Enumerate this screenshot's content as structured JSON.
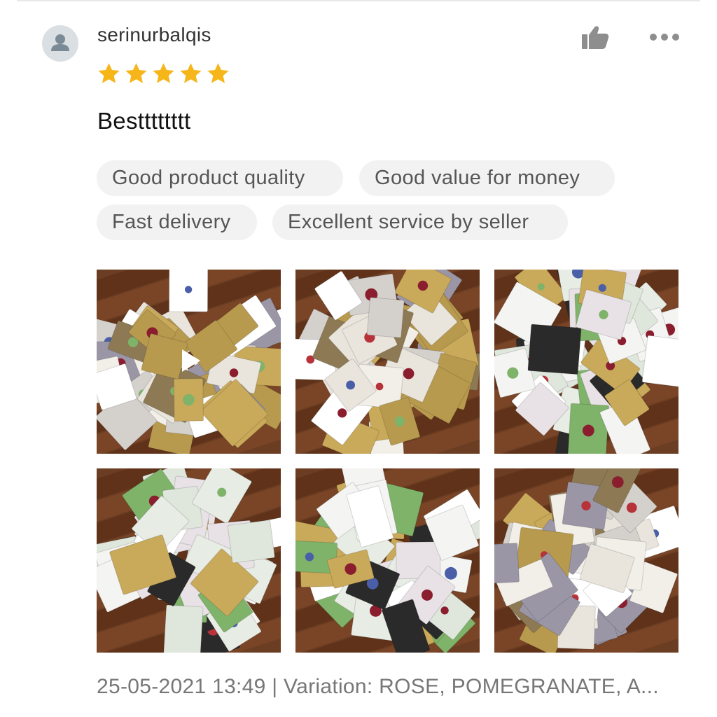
{
  "review": {
    "username": "serinurbalqis",
    "rating": 5,
    "max_rating": 5,
    "text": "Bestttttttt",
    "tags": [
      "Good product quality",
      "Good value for money",
      "Fast delivery",
      "Excellent service by seller"
    ],
    "footer": "25-05-2021 13:49 | Variation: ROSE, POMEGRANATE, A..."
  },
  "icons": {
    "avatar": "user-avatar-icon",
    "like": "thumbs-up-icon",
    "more": "more-dots-icon",
    "star": "star-icon",
    "play": "play-icon"
  },
  "media": [
    {
      "kind": "video",
      "content": "eye-mask-packets-circle"
    },
    {
      "kind": "photo",
      "content": "eye-mask-packets-circle"
    },
    {
      "kind": "photo",
      "content": "face-mask-packets-circle"
    },
    {
      "kind": "photo",
      "content": "face-mask-packets-circle"
    },
    {
      "kind": "photo",
      "content": "face-mask-packets-circle"
    },
    {
      "kind": "photo",
      "content": "eye-mask-packets-circle"
    }
  ],
  "colors": {
    "star": "#f6b619",
    "tag_bg": "#f2f2f2",
    "tag_text": "#555555",
    "floor": "#6b3d22",
    "icon_gray": "#8e8e8e"
  }
}
